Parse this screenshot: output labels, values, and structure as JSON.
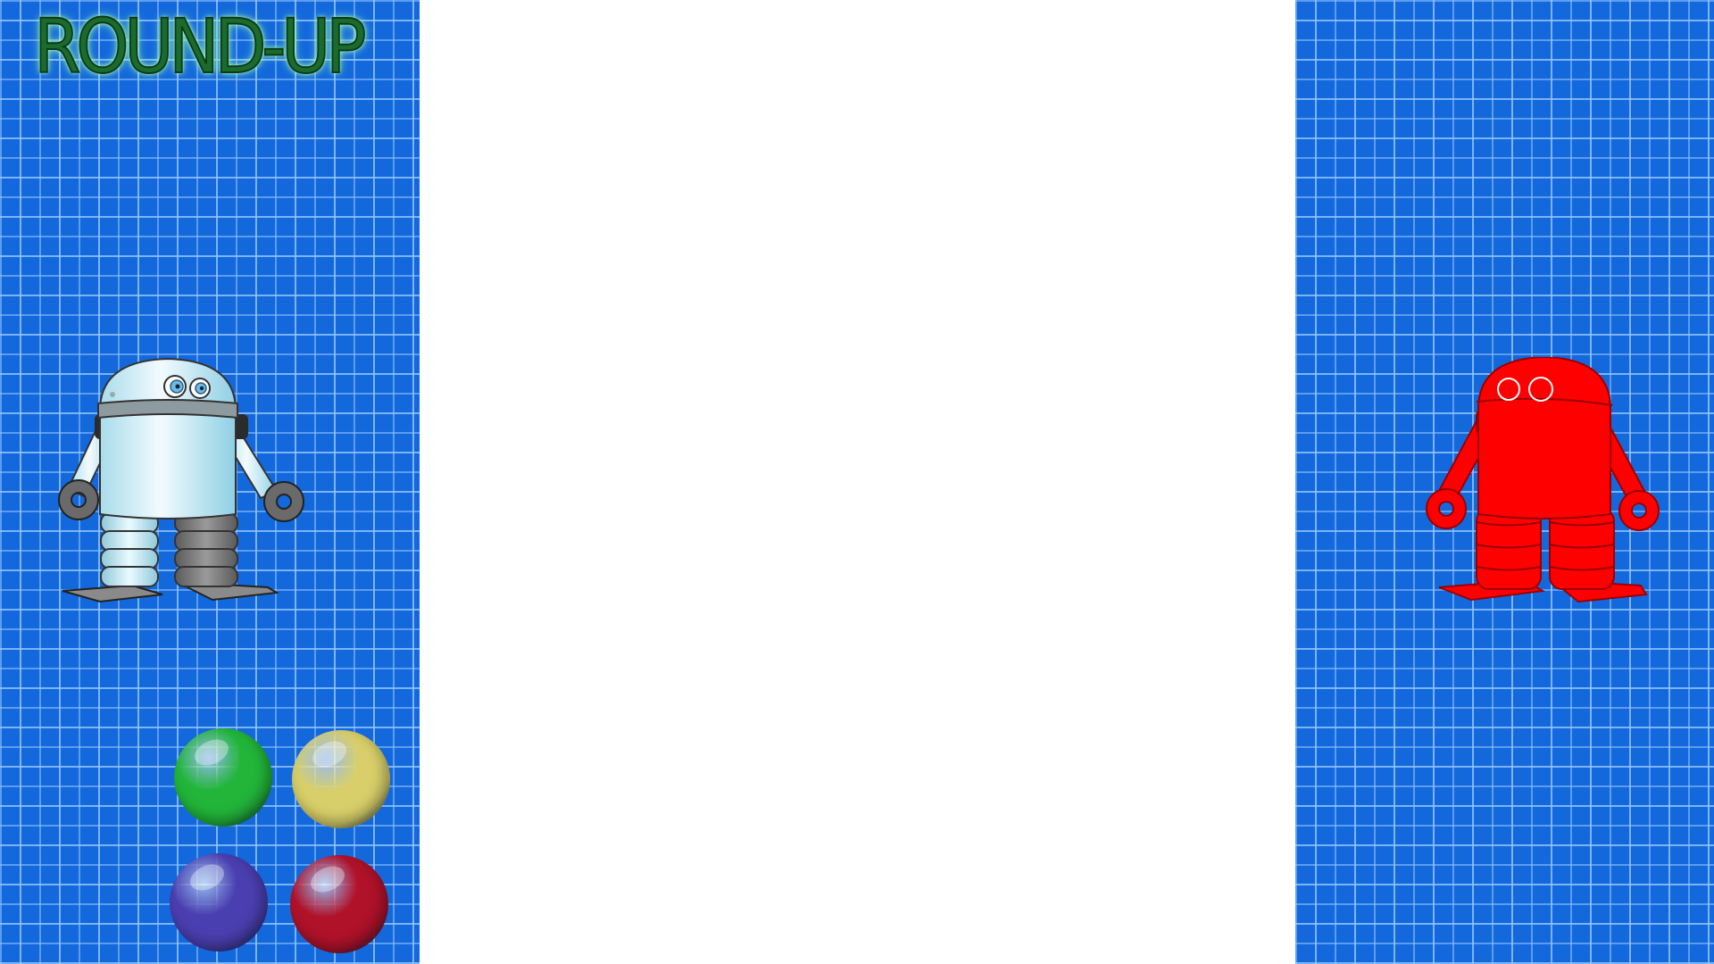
{
  "game": {
    "title": "ROUND-UP"
  },
  "colors": {
    "panel_blue": "#1368dc",
    "brick_line": "#96c8ff",
    "play_area": "#ffffff",
    "title_green": "#1a6b2c",
    "player_robot": "#dff4fb",
    "opponent_robot": "#ff0000"
  },
  "balls": [
    {
      "name": "green",
      "color": "#22b53a"
    },
    {
      "name": "yellow",
      "color": "#d8cf6a"
    },
    {
      "name": "blue",
      "color": "#4a3fb0"
    },
    {
      "name": "red",
      "color": "#b0122a"
    }
  ],
  "robots": {
    "player": {
      "icon": "white-robot-icon"
    },
    "opponent": {
      "icon": "red-robot-icon"
    }
  }
}
